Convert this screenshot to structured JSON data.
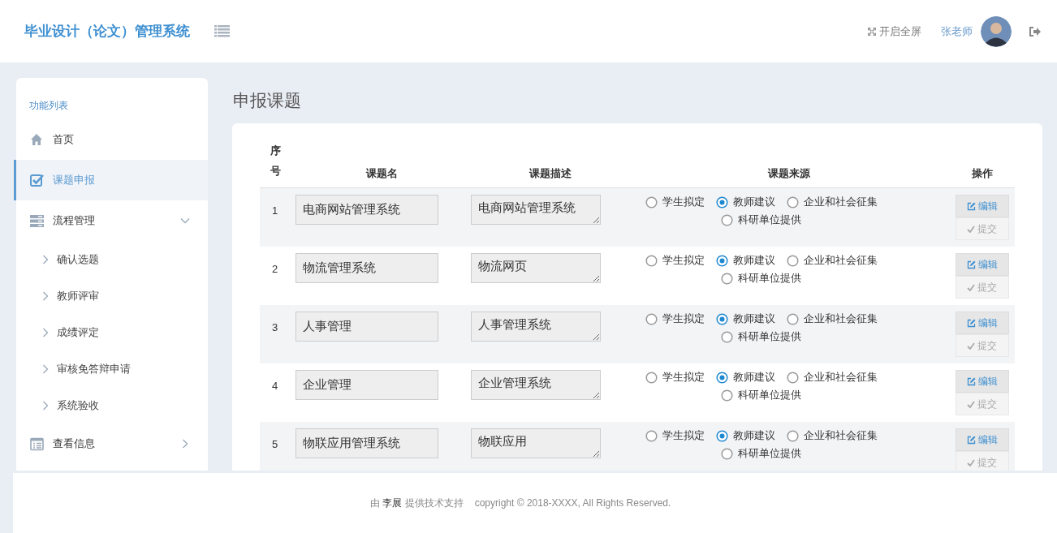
{
  "header": {
    "title": "毕业设计（论文）管理系统",
    "fullscreen": "开启全屏",
    "user": "张老师"
  },
  "sidebar": {
    "heading": "功能列表",
    "items": [
      {
        "label": "首页",
        "selected": false
      },
      {
        "label": "课题申报",
        "selected": true
      },
      {
        "label": "流程管理",
        "selected": false,
        "expanded": true,
        "children": [
          {
            "label": "确认选题",
            "selected": false
          },
          {
            "label": "教师评审",
            "selected": false
          },
          {
            "label": "成绩评定",
            "selected": false
          },
          {
            "label": "审核免答辩申请",
            "selected": false
          },
          {
            "label": "系统验收",
            "selected": false
          }
        ]
      },
      {
        "label": "查看信息",
        "selected": false,
        "expanded": false
      }
    ]
  },
  "page_title": "申报课题",
  "table": {
    "columns": [
      "序号",
      "课题名",
      "课题描述",
      "课题来源",
      "操作"
    ],
    "rows": [
      {
        "index": "1",
        "name": "电商网站管理系统",
        "description": "电商网站管理系统",
        "sources": [
          {
            "label": "学生拟定",
            "selected": false
          },
          {
            "label": "教师建议",
            "selected": true
          },
          {
            "label": "企业和社会征集",
            "selected": false
          },
          {
            "label": "科研单位提供",
            "selected": false
          }
        ],
        "actions": [
          "编辑",
          "提交"
        ]
      },
      {
        "index": "2",
        "name": "物流管理系统",
        "description": "物流网页",
        "sources": [
          {
            "label": "学生拟定",
            "selected": false
          },
          {
            "label": "教师建议",
            "selected": true
          },
          {
            "label": "企业和社会征集",
            "selected": false
          },
          {
            "label": "科研单位提供",
            "selected": false
          }
        ],
        "actions": [
          "编辑",
          "提交"
        ]
      },
      {
        "index": "3",
        "name": "人事管理",
        "description": "人事管理系统",
        "sources": [
          {
            "label": "学生拟定",
            "selected": false
          },
          {
            "label": "教师建议",
            "selected": true
          },
          {
            "label": "企业和社会征集",
            "selected": false
          },
          {
            "label": "科研单位提供",
            "selected": false
          }
        ],
        "actions": [
          "编辑",
          "提交"
        ]
      },
      {
        "index": "4",
        "name": "企业管理",
        "description": "企业管理系统",
        "sources": [
          {
            "label": "学生拟定",
            "selected": false
          },
          {
            "label": "教师建议",
            "selected": true
          },
          {
            "label": "企业和社会征集",
            "selected": false
          },
          {
            "label": "科研单位提供",
            "selected": false
          }
        ],
        "actions": [
          "编辑",
          "提交"
        ]
      },
      {
        "index": "5",
        "name": "物联应用管理系统",
        "description": "物联应用",
        "sources": [
          {
            "label": "学生拟定",
            "selected": false
          },
          {
            "label": "教师建议",
            "selected": true
          },
          {
            "label": "企业和社会征集",
            "selected": false
          },
          {
            "label": "科研单位提供",
            "selected": false
          }
        ],
        "actions": [
          "编辑",
          "提交"
        ]
      }
    ]
  },
  "footer": {
    "support": "由 **李展** 提供技术支持",
    "copyright": "copyright © 2018-XXXX, All Rights Reserved."
  }
}
